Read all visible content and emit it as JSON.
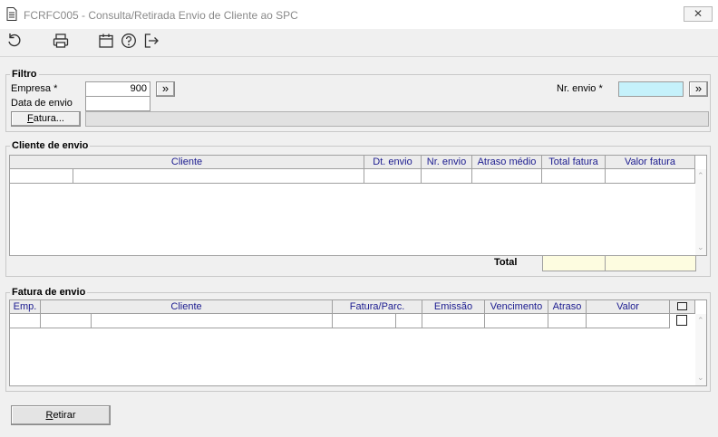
{
  "window": {
    "title": "FCRFC005 - Consulta/Retirada Envio de Cliente ao SPC",
    "close_glyph": "✕"
  },
  "toolbar": {
    "icons": [
      "refresh-icon",
      "print-icon",
      "calendar-icon",
      "help-icon",
      "exit-icon"
    ]
  },
  "filtro": {
    "legend": "Filtro",
    "empresa_label": "Empresa *",
    "empresa_value": "900",
    "data_envio_label": "Data de envio",
    "data_envio_value": "",
    "fatura_button": "Fatura...",
    "nr_envio_label": "Nr. envio *",
    "nr_envio_value": "",
    "lookup_glyph": "»"
  },
  "cliente_envio": {
    "legend": "Cliente de envio",
    "columns": [
      "Cliente",
      "Dt. envio",
      "Nr. envio",
      "Atraso médio",
      "Total fatura",
      "Valor fatura"
    ],
    "total_label": "Total"
  },
  "fatura_envio": {
    "legend": "Fatura de envio",
    "columns": [
      "Emp.",
      "Cliente",
      "Fatura/Parc.",
      "Emissão",
      "Vencimento",
      "Atraso",
      "Valor"
    ]
  },
  "footer": {
    "retirar_button": "Retirar"
  },
  "colors": {
    "nr_envio_bg": "#c5f1fb",
    "total_bg": "#fdfce0",
    "header_text": "#1b1b8f"
  }
}
